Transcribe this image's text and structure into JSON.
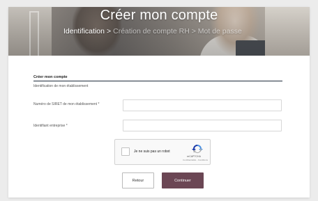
{
  "header": {
    "title": "Créer mon compte",
    "breadcrumb": {
      "step1": "Identification",
      "separator": ">",
      "step2": "Création de compte RH > Mot de passe"
    }
  },
  "form": {
    "section_title": "Créer mon compte",
    "section_subtitle": "Identification de mon établissement",
    "fields": [
      {
        "label": "Numéro de SIRET de mon établissement *",
        "value": "",
        "placeholder": ""
      },
      {
        "label": "Identifiant entreprise *",
        "value": "",
        "placeholder": ""
      }
    ]
  },
  "captcha": {
    "label": "Je ne suis pas un robot",
    "brand": "reCAPTCHA",
    "terms": "Confidentialité - Conditions",
    "checked": false
  },
  "actions": {
    "back_label": "Retour",
    "continue_label": "Continuer"
  },
  "colors": {
    "primary_button": "#6b4654",
    "rule": "#1e2b3a",
    "captcha_blue": "#4a90e2"
  }
}
